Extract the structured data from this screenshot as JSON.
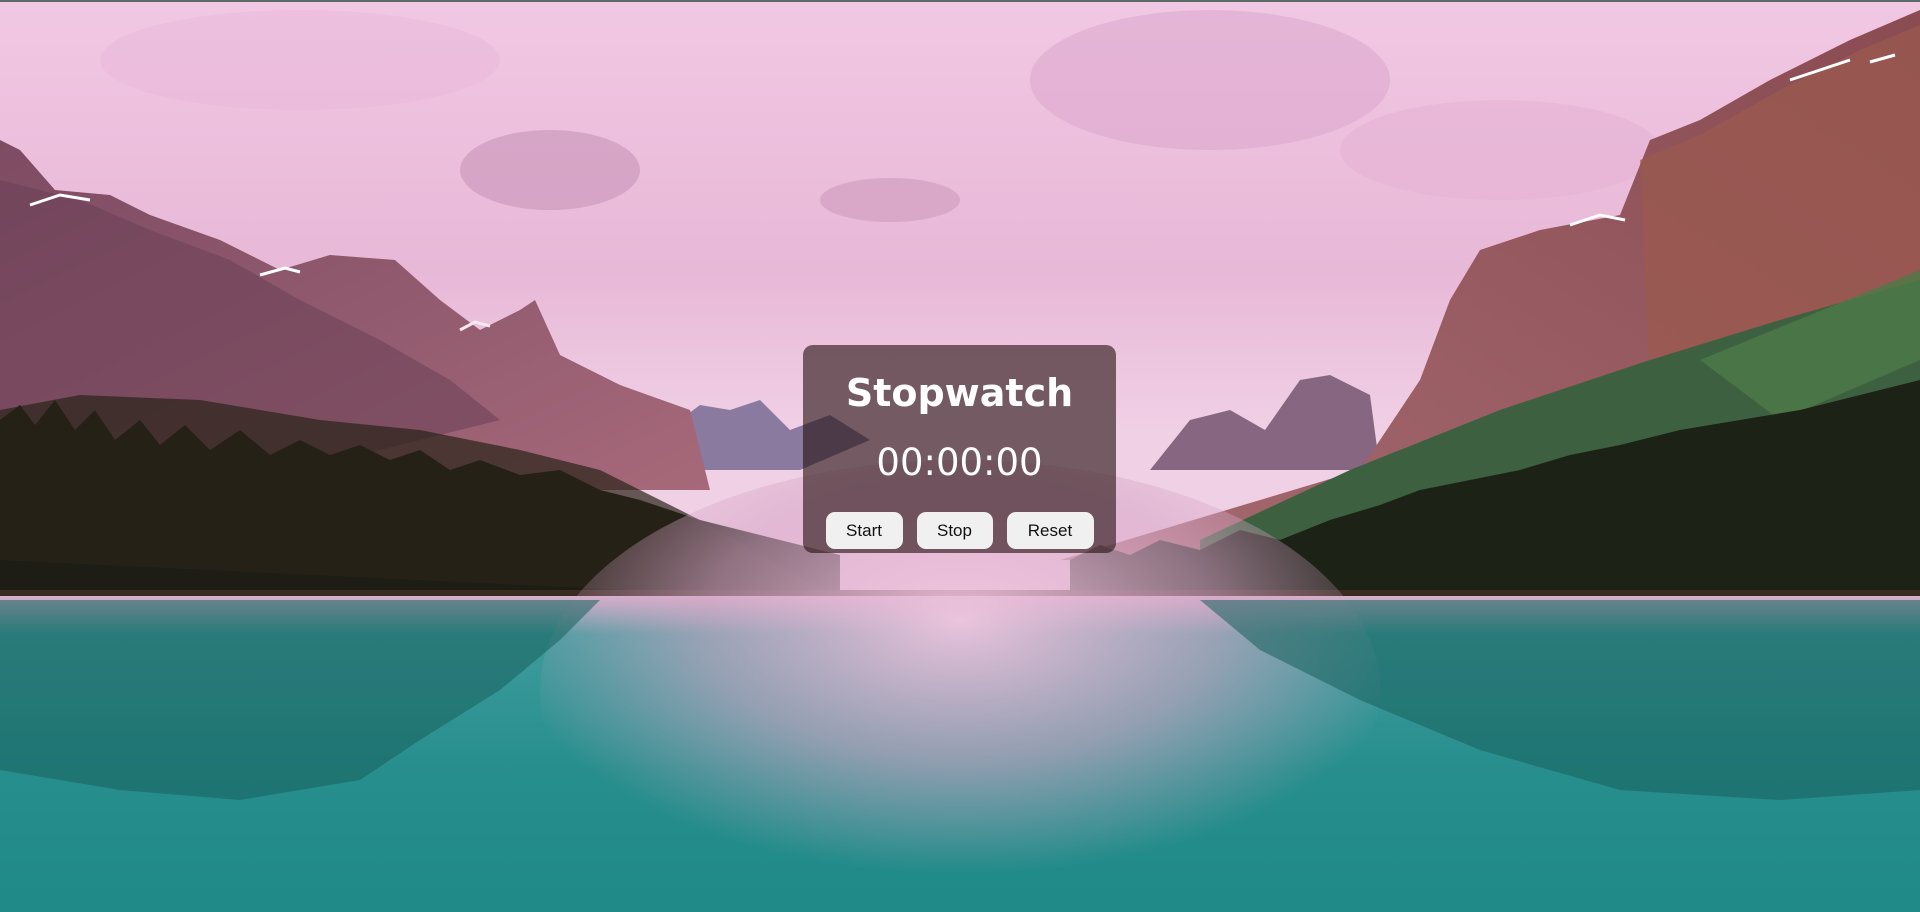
{
  "stopwatch": {
    "title": "Stopwatch",
    "time": "00:00:00",
    "start_label": "Start",
    "stop_label": "Stop",
    "reset_label": "Reset"
  },
  "colors": {
    "sky": "#e6b7d6",
    "card_background": "rgba(40,20,20,0.62)",
    "button_background": "#f0f0f0",
    "lake": "#2f9b9a"
  }
}
